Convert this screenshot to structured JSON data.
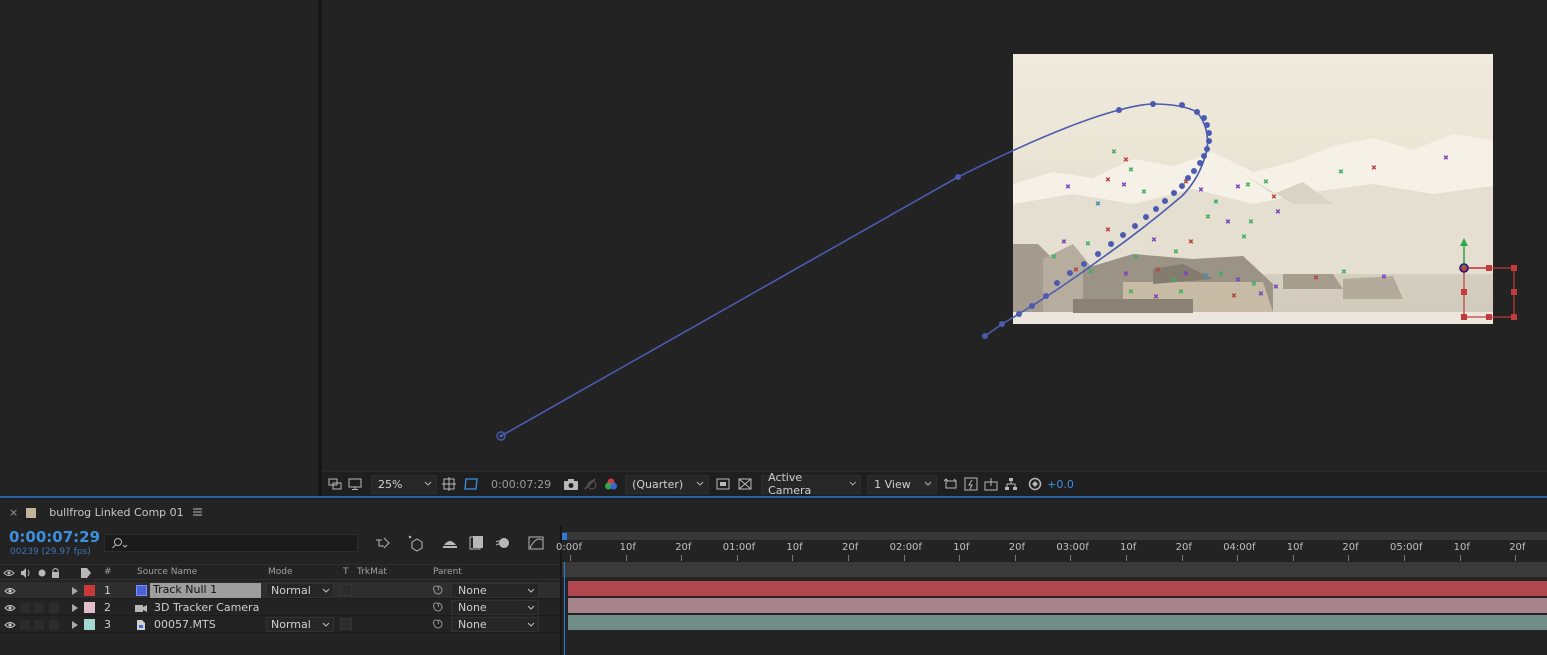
{
  "viewer": {
    "zoom": "25%",
    "timecode": "0:00:07:29",
    "resolution": "(Quarter)",
    "camera": "Active Camera",
    "views": "1 View",
    "exposure": "+0.0"
  },
  "composition": {
    "name": "bullfrog Linked Comp 01",
    "timecode": "0:00:07:29",
    "frame_info": "00239 (29.97 fps)"
  },
  "columns": {
    "number": "#",
    "source_name": "Source Name",
    "mode": "Mode",
    "t": "T",
    "trkmat": "TrkMat",
    "parent": "Parent"
  },
  "layers": [
    {
      "num": "1",
      "name": "Track Null 1",
      "mode": "Normal",
      "parent": "None",
      "label_color": "#4a63d8",
      "bar_color": "#b0474f"
    },
    {
      "num": "2",
      "name": "3D Tracker Camera",
      "mode": "",
      "parent": "None",
      "label_color": "#e0b9c9",
      "bar_color": "#a7838c"
    },
    {
      "num": "3",
      "name": "00057.MTS",
      "mode": "Normal",
      "parent": "None",
      "label_color": "#9fd6cf",
      "bar_color": "#6f8c86"
    }
  ],
  "ruler": {
    "labels": [
      "0:00f",
      "10f",
      "20f",
      "01:00f",
      "10f",
      "20f",
      "02:00f",
      "10f",
      "20f",
      "03:00f",
      "10f",
      "20f",
      "04:00f",
      "10f",
      "20f",
      "05:00f",
      "10f",
      "20f"
    ]
  },
  "colors": {
    "accent": "#3d8fe0",
    "motion_path": "#4a5bb0",
    "selection_red": "#c23b3b"
  }
}
